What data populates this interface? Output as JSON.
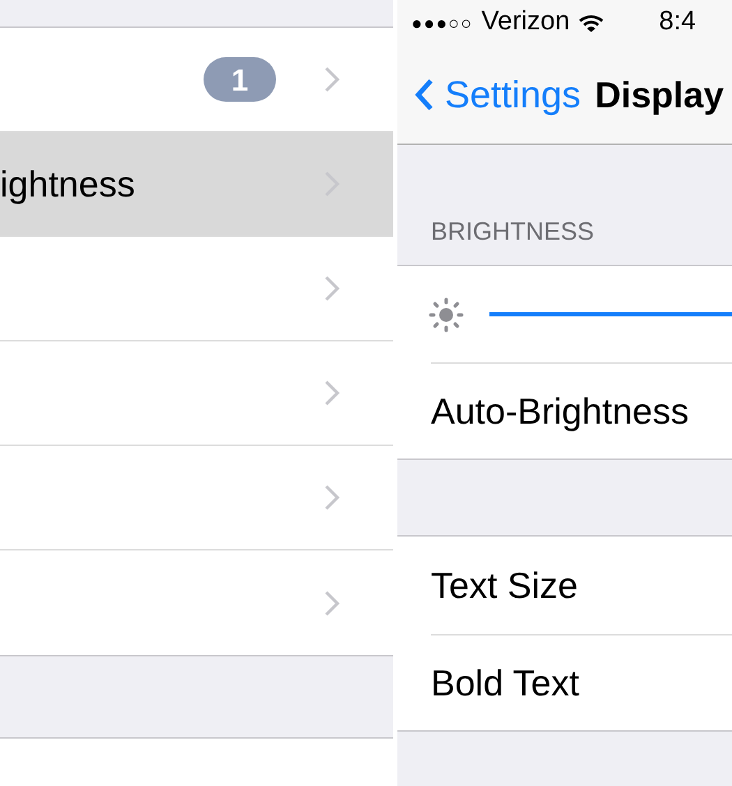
{
  "left_panel": {
    "rows": [
      {
        "label": "",
        "badge": "1",
        "selected": false
      },
      {
        "label": "ightness",
        "selected": true
      },
      {
        "label": "",
        "selected": false
      },
      {
        "label": "",
        "selected": false
      },
      {
        "label": "",
        "selected": false
      },
      {
        "label": "",
        "selected": false
      }
    ]
  },
  "right_panel": {
    "status_bar": {
      "signal": "●●●○○",
      "carrier": "Verizon",
      "time": "8:4"
    },
    "nav_bar": {
      "back": "Settings",
      "title": "Display"
    },
    "brightness_section": {
      "header": "BRIGHTNESS",
      "slider": {
        "level": 1
      },
      "row": "Auto-Brightness"
    },
    "text_section": {
      "rows": [
        "Text Size",
        "Bold Text"
      ]
    }
  }
}
